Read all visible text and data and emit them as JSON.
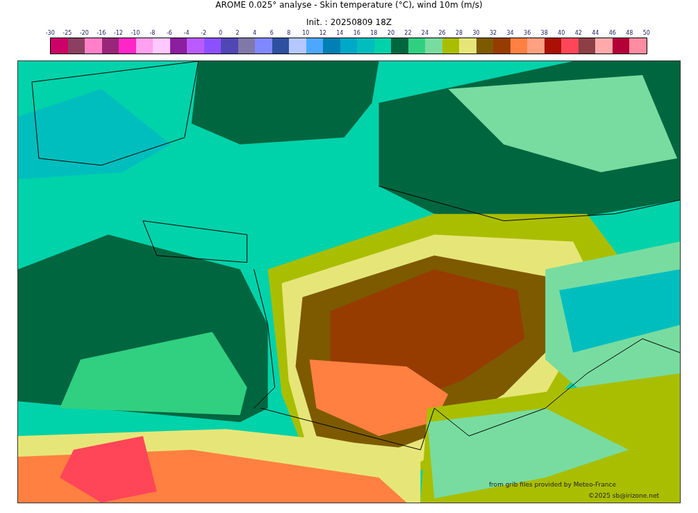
{
  "title": "AROME 0.025° analyse - Skin temperature (°C), wind 10m (m/s)",
  "subtitle": "Init. : 20250809 18Z",
  "colorbar": {
    "ticks": [
      "-30",
      "-25",
      "-20",
      "-16",
      "-12",
      "-10",
      "-8",
      "-6",
      "-4",
      "-2",
      "0",
      "2",
      "4",
      "6",
      "8",
      "10",
      "12",
      "14",
      "16",
      "18",
      "20",
      "22",
      "24",
      "26",
      "28",
      "30",
      "32",
      "34",
      "36",
      "38",
      "40",
      "42",
      "44",
      "46",
      "48",
      "50"
    ],
    "segments": [
      {
        "color": "#cc0066"
      },
      {
        "color": "#8b4060"
      },
      {
        "color": "#ff80c8"
      },
      {
        "color": "#99267a"
      },
      {
        "color": "#ff26c8"
      },
      {
        "color": "#ffa0f0"
      },
      {
        "color": "#ffc8ff"
      },
      {
        "color": "#8c1ea0"
      },
      {
        "color": "#bb5aff"
      },
      {
        "color": "#8c50ff"
      },
      {
        "color": "#5046b4"
      },
      {
        "color": "#8078a8"
      },
      {
        "color": "#8088ff"
      },
      {
        "color": "#2d50a0"
      },
      {
        "color": "#b4c8ff"
      },
      {
        "color": "#4ca8ff"
      },
      {
        "color": "#0080b4"
      },
      {
        "color": "#00a8c8"
      },
      {
        "color": "#00bebe"
      },
      {
        "color": "#00d2aa"
      },
      {
        "color": "#006640"
      },
      {
        "color": "#30d080"
      },
      {
        "color": "#78dca0"
      },
      {
        "color": "#aabe00"
      },
      {
        "color": "#e6e678"
      },
      {
        "color": "#7d5a00"
      },
      {
        "color": "#963c00"
      },
      {
        "color": "#ff8040"
      },
      {
        "color": "#ffa080"
      },
      {
        "color": "#aa1005"
      },
      {
        "color": "#ff4658"
      },
      {
        "color": "#8c4046"
      },
      {
        "color": "#ffaaaa"
      },
      {
        "color": "#b40038"
      },
      {
        "color": "#ff8ca0"
      }
    ]
  },
  "map": {
    "credits": [
      "from grib files provided by Meteo-France",
      "©2025 sb@irizone.net"
    ]
  }
}
